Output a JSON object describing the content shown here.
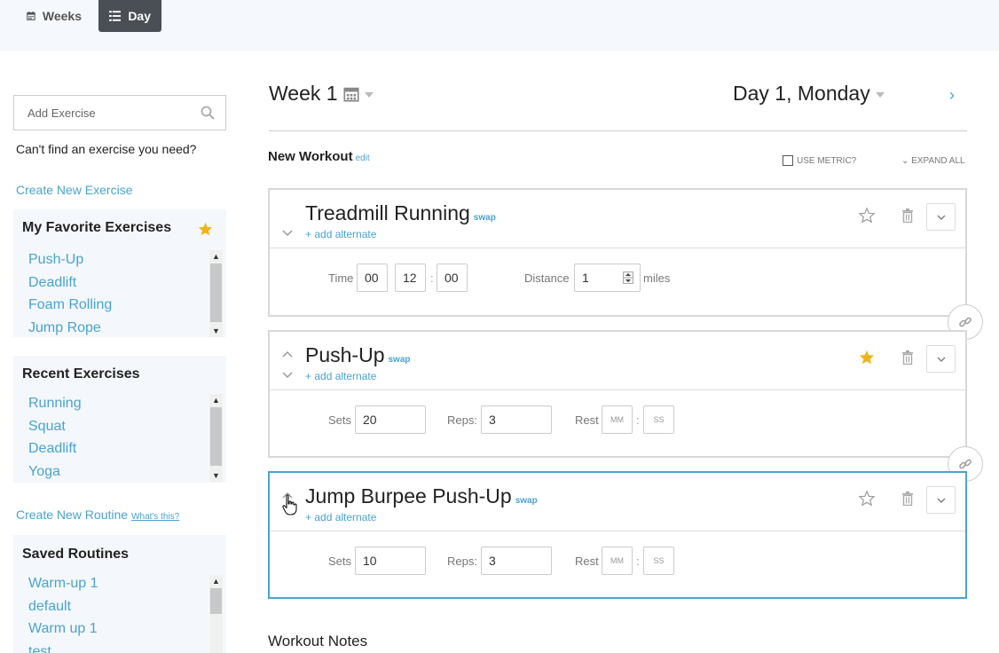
{
  "view_toggle": {
    "weeks_label": "Weeks",
    "day_label": "Day"
  },
  "sidebar": {
    "search_placeholder": "Add Exercise",
    "cant_find_text": "Can't find an exercise you need?",
    "create_exercise_link": "Create New Exercise",
    "favorites": {
      "title": "My Favorite Exercises",
      "items": [
        "Push-Up",
        "Deadlift",
        "Foam Rolling",
        "Jump Rope"
      ]
    },
    "recent": {
      "title": "Recent Exercises",
      "items": [
        "Running",
        "Squat",
        "Deadlift",
        "Yoga"
      ]
    },
    "create_routine_link": "Create New Routine",
    "whats_this": "What's this?",
    "saved": {
      "title": "Saved Routines",
      "items": [
        "Warm-up 1",
        "default",
        "Warm up 1",
        "test"
      ]
    }
  },
  "header": {
    "week_label": "Week 1",
    "day_label": "Day 1, Monday",
    "next_arrow": "›"
  },
  "workout": {
    "name": "New Workout",
    "edit_label": "edit",
    "use_metric_label": "USE METRIC?",
    "expand_all_label": "EXPAND ALL",
    "swap_label": "swap",
    "add_alternate_label": "+ add alternate",
    "exercises": [
      {
        "name": "Treadmill Running",
        "favorite": false,
        "time_label": "Time",
        "time_hh": "00",
        "time_mm": "12",
        "time_ss": "00",
        "distance_label": "Distance",
        "distance_value": "1",
        "distance_unit": "miles"
      },
      {
        "name": "Push-Up",
        "favorite": true,
        "sets_label": "Sets",
        "sets_value": "20",
        "reps_label": "Reps:",
        "reps_value": "3",
        "rest_label": "Rest",
        "rest_mm": "MM",
        "rest_ss": "SS"
      },
      {
        "name": "Jump Burpee Push-Up",
        "favorite": false,
        "sets_label": "Sets",
        "sets_value": "10",
        "reps_label": "Reps:",
        "reps_value": "3",
        "rest_label": "Rest",
        "rest_mm": "MM",
        "rest_ss": "SS"
      }
    ],
    "notes_label": "Workout Notes"
  },
  "colors": {
    "accent": "#4aa3cf",
    "star": "#f0b31c",
    "panel_bg": "#f4f8fc",
    "active_border": "#4aa3cf"
  }
}
